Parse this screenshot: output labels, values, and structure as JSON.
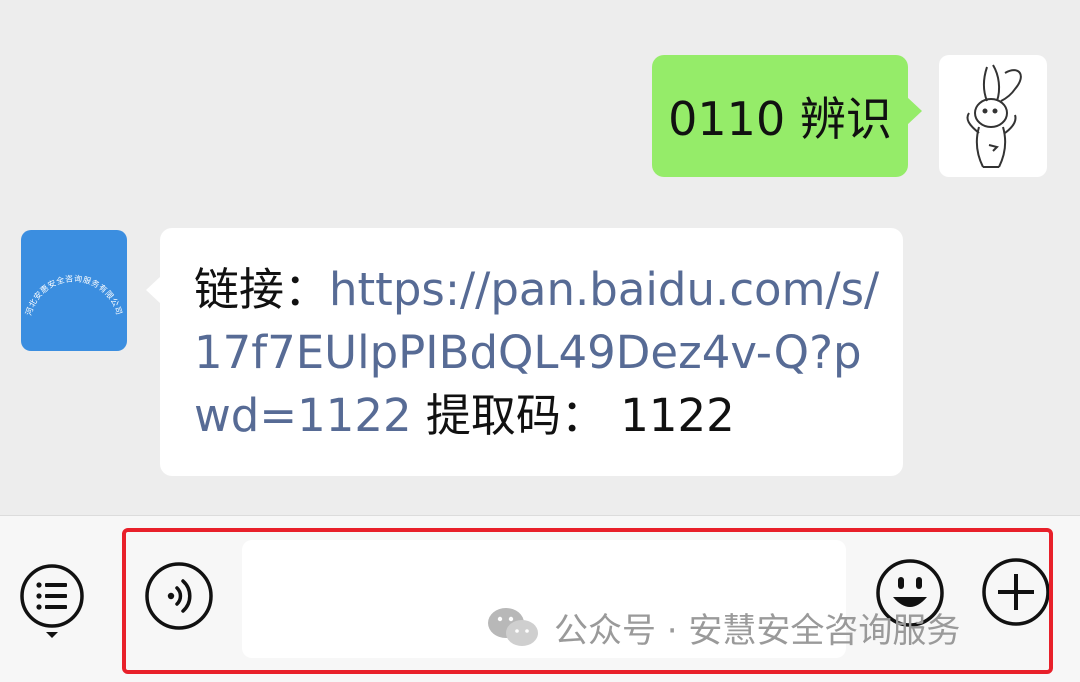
{
  "messages": {
    "outgoing": {
      "text": "0110 辨识"
    },
    "incoming": {
      "prefix": "链接：",
      "link": "https://pan.baidu.com/s/17f7EUlpPIBdQL49Dez4v-Q?pwd=1122",
      "suffix": " 提取码：  1122",
      "avatar_text": "河北安惠安全咨询服务有限公司"
    }
  },
  "input_bar": {
    "placeholder": ""
  },
  "watermark": {
    "text": "公众号 · 安慧安全咨询服务"
  },
  "colors": {
    "outgoing_bubble": "#95ec69",
    "link": "#576b95",
    "avatar_blue": "#3b8ee0",
    "highlight": "#e8202a"
  },
  "icons": [
    "menu-icon",
    "voice-icon",
    "emoji-icon",
    "plus-icon",
    "wechat-logo-icon"
  ]
}
